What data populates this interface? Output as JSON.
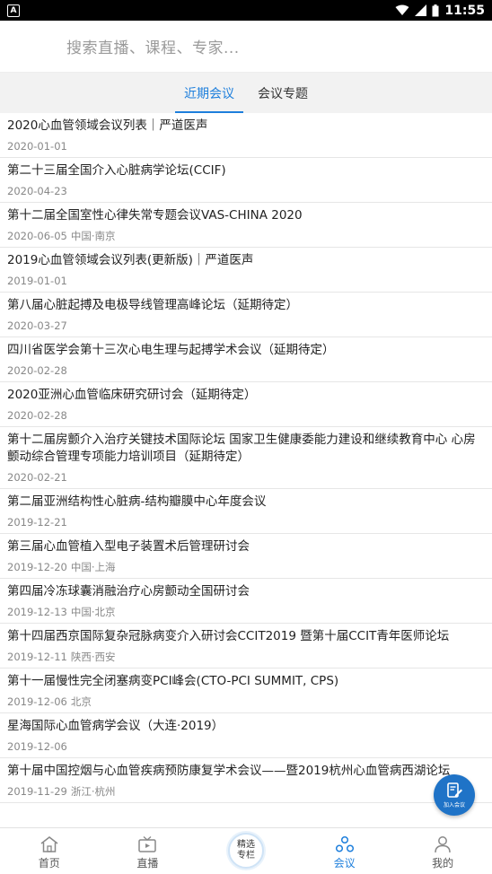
{
  "status_bar": {
    "app_badge": "A",
    "time": "11:55"
  },
  "search": {
    "placeholder": "搜索直播、课程、专家..."
  },
  "tabs": [
    {
      "label": "近期会议",
      "active": true
    },
    {
      "label": "会议专题",
      "active": false
    }
  ],
  "meetings": [
    {
      "title": "2020心血管领域会议列表｜严道医声",
      "date": "2020-01-01",
      "location": ""
    },
    {
      "title": "第二十三届全国介入心脏病学论坛(CCIF)",
      "date": "2020-04-23",
      "location": ""
    },
    {
      "title": "第十二届全国室性心律失常专题会议VAS-CHINA 2020",
      "date": "2020-06-05",
      "location": "中国·南京"
    },
    {
      "title": "2019心血管领域会议列表(更新版)｜严道医声",
      "date": "2019-01-01",
      "location": ""
    },
    {
      "title": "第八届心脏起搏及电极导线管理高峰论坛（延期待定）",
      "date": "2020-03-27",
      "location": ""
    },
    {
      "title": "四川省医学会第十三次心电生理与起搏学术会议（延期待定）",
      "date": "2020-02-28",
      "location": ""
    },
    {
      "title": "2020亚洲心血管临床研究研讨会（延期待定）",
      "date": "2020-02-28",
      "location": ""
    },
    {
      "title": "第十二届房颤介入治疗关键技术国际论坛 国家卫生健康委能力建设和继续教育中心 心房颤动综合管理专项能力培训项目（延期待定）",
      "date": "2020-02-21",
      "location": ""
    },
    {
      "title": "第二届亚洲结构性心脏病-结构瓣膜中心年度会议",
      "date": "2019-12-21",
      "location": ""
    },
    {
      "title": "第三届心血管植入型电子装置术后管理研讨会",
      "date": "2019-12-20",
      "location": "中国·上海"
    },
    {
      "title": "第四届冷冻球囊消融治疗心房颤动全国研讨会",
      "date": "2019-12-13",
      "location": "中国·北京"
    },
    {
      "title": "第十四届西京国际复杂冠脉病变介入研讨会CCIT2019 暨第十届CCIT青年医师论坛",
      "date": "2019-12-11",
      "location": "陕西·西安"
    },
    {
      "title": "第十一届慢性完全闭塞病变PCI峰会(CTO-PCI SUMMIT, CPS)",
      "date": "2019-12-06",
      "location": "北京"
    },
    {
      "title": "星海国际心血管病学会议（大连·2019）",
      "date": "2019-12-06",
      "location": ""
    },
    {
      "title": "第十届中国控烟与心血管疾病预防康复学术会议——暨2019杭州心血管病西湖论坛",
      "date": "2019-11-29",
      "location": "浙江·杭州"
    }
  ],
  "fab": {
    "label": "加入会议",
    "icon": "edit-document-icon"
  },
  "bottom_nav": {
    "home": {
      "label": "首页",
      "icon": "home-icon"
    },
    "live": {
      "label": "直播",
      "icon": "tv-icon"
    },
    "featured": {
      "line1": "精选",
      "line2": "专栏"
    },
    "meeting": {
      "label": "会议",
      "icon": "meeting-icon",
      "active": true
    },
    "mine": {
      "label": "我的",
      "icon": "user-icon"
    }
  },
  "colors": {
    "accent": "#1e7fdc",
    "fab": "#1f73c7",
    "tab_bg": "#f2f2f2"
  }
}
